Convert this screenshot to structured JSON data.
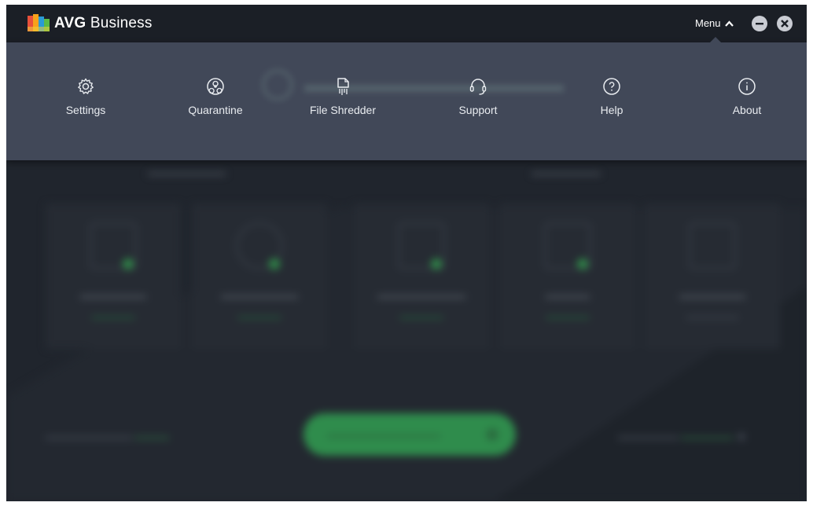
{
  "app": {
    "brand": "AVG",
    "product": "Business"
  },
  "titlebar": {
    "menu_label": "Menu",
    "minimize_icon": "minus-circle-icon",
    "close_icon": "x-circle-icon"
  },
  "menu": {
    "items": [
      {
        "label": "Settings",
        "icon": "gear-icon"
      },
      {
        "label": "Quarantine",
        "icon": "biohazard-icon"
      },
      {
        "label": "File Shredder",
        "icon": "shredder-icon"
      },
      {
        "label": "Support",
        "icon": "headset-icon"
      },
      {
        "label": "Help",
        "icon": "question-circle-icon"
      },
      {
        "label": "About",
        "icon": "info-circle-icon"
      }
    ]
  },
  "colors": {
    "accent_green": "#2f8c4c",
    "background": "#20252d",
    "menu_panel": "#414858"
  }
}
